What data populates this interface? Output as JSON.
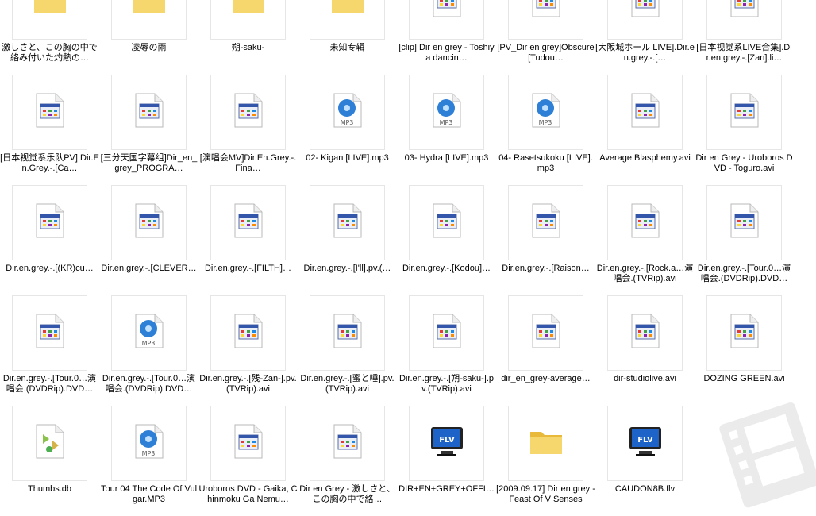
{
  "items": [
    {
      "label": "激しさと、この胸の中で絡み付いた灼熱の…",
      "icon": "folder-icon",
      "row": 0,
      "col": 0
    },
    {
      "label": "凌辱の雨",
      "icon": "folder-icon",
      "row": 0,
      "col": 1
    },
    {
      "label": "朔-saku-",
      "icon": "folder-icon",
      "row": 0,
      "col": 2
    },
    {
      "label": "未知专辑",
      "icon": "folder-icon",
      "row": 0,
      "col": 3
    },
    {
      "label": "[clip] Dir en grey - Toshiya dancin…",
      "icon": "video-file-icon",
      "row": 0,
      "col": 4
    },
    {
      "label": "[PV_Dir en grey]Obscure[Tudou…",
      "icon": "video-file-icon",
      "row": 0,
      "col": 5
    },
    {
      "label": "[大阪城ホール LIVE].Dir.en.grey.-.[…",
      "icon": "video-file-icon",
      "row": 0,
      "col": 6
    },
    {
      "label": "[日本视觉系LIVE合集].Dir.en.grey.-.[Zan].li…",
      "icon": "video-file-icon",
      "row": 0,
      "col": 7
    },
    {
      "label": "[日本视觉系乐队PV].Dir.En.Grey.-.[Ca…",
      "icon": "video-file-icon",
      "row": 1,
      "col": 0
    },
    {
      "label": "[三分天国字幕组]Dir_en_grey_PROGRA…",
      "icon": "video-file-icon",
      "row": 1,
      "col": 1
    },
    {
      "label": "[演唱会MV]Dir.En.Grey.-.Fina…",
      "icon": "video-file-icon",
      "row": 1,
      "col": 2
    },
    {
      "label": "02- Kigan [LIVE].mp3",
      "icon": "mp3-file-icon",
      "row": 1,
      "col": 3
    },
    {
      "label": "03- Hydra [LIVE].mp3",
      "icon": "mp3-file-icon",
      "row": 1,
      "col": 4
    },
    {
      "label": "04- Rasetsukoku [LIVE].mp3",
      "icon": "mp3-file-icon",
      "row": 1,
      "col": 5
    },
    {
      "label": "Average Blasphemy.avi",
      "icon": "video-file-icon",
      "row": 1,
      "col": 6
    },
    {
      "label": "Dir en Grey - Uroboros DVD - Toguro.avi",
      "icon": "video-file-icon",
      "row": 1,
      "col": 7
    },
    {
      "label": "Dir.en.grey.-.[(KR)cu…",
      "icon": "video-file-icon",
      "row": 2,
      "col": 0
    },
    {
      "label": "Dir.en.grey.-.[CLEVER…",
      "icon": "video-file-icon",
      "row": 2,
      "col": 1
    },
    {
      "label": "Dir.en.grey.-.[FILTH]…",
      "icon": "video-file-icon",
      "row": 2,
      "col": 2
    },
    {
      "label": "Dir.en.grey.-.[I'll].pv.(…",
      "icon": "video-file-icon",
      "row": 2,
      "col": 3
    },
    {
      "label": "Dir.en.grey.-.[Kodou]…",
      "icon": "video-file-icon",
      "row": 2,
      "col": 4
    },
    {
      "label": "Dir.en.grey.-.[Raison…",
      "icon": "video-file-icon",
      "row": 2,
      "col": 5
    },
    {
      "label": "Dir.en.grey.-.[Rock.a…演唱会.(TVRip).avi",
      "icon": "video-file-icon",
      "row": 2,
      "col": 6
    },
    {
      "label": "Dir.en.grey.-.[Tour.0…演唱会.(DVDRip).DVD…",
      "icon": "video-file-icon",
      "row": 2,
      "col": 7
    },
    {
      "label": "Dir.en.grey.-.[Tour.0…演唱会.(DVDRip).DVD…",
      "icon": "video-file-icon",
      "row": 3,
      "col": 0
    },
    {
      "label": "Dir.en.grey.-.[Tour.0…演唱会.(DVDRip).DVD…",
      "icon": "mp3-file-icon",
      "row": 3,
      "col": 1
    },
    {
      "label": "Dir.en.grey.-.[残-Zan-].pv.(TVRip).avi",
      "icon": "video-file-icon",
      "row": 3,
      "col": 2
    },
    {
      "label": "Dir.en.grey.-.[蜜と唾].pv.(TVRip).avi",
      "icon": "video-file-icon",
      "row": 3,
      "col": 3
    },
    {
      "label": "Dir.en.grey.-.[朔-saku-].pv.(TVRip).avi",
      "icon": "video-file-icon",
      "row": 3,
      "col": 4
    },
    {
      "label": "dir_en_grey-average…",
      "icon": "video-file-icon",
      "row": 3,
      "col": 5
    },
    {
      "label": "dir-studiolive.avi",
      "icon": "video-file-icon",
      "row": 3,
      "col": 6
    },
    {
      "label": "DOZING GREEN.avi",
      "icon": "video-file-icon",
      "row": 3,
      "col": 7
    },
    {
      "label": "Thumbs.db",
      "icon": "db-file-icon",
      "row": 4,
      "col": 0
    },
    {
      "label": "Tour 04 The Code Of Vulgar.MP3",
      "icon": "mp3-file-icon",
      "row": 4,
      "col": 1
    },
    {
      "label": "Uroboros DVD - Gaika, Chinmoku Ga Nemu…",
      "icon": "video-file-icon",
      "row": 4,
      "col": 2
    },
    {
      "label": "Dir en Grey - 激しさと、この胸の中で絡…",
      "icon": "video-file-icon",
      "row": 4,
      "col": 3
    },
    {
      "label": "DIR+EN+GREY+OFFI…",
      "icon": "flv-file-icon",
      "row": 4,
      "col": 4
    },
    {
      "label": "[2009.09.17] Dir en grey - Feast Of V Senses",
      "icon": "folder-icon",
      "row": 4,
      "col": 5
    },
    {
      "label": "CAUDON8B.flv",
      "icon": "flv-file-icon",
      "row": 4,
      "col": 6
    }
  ],
  "colors": {
    "folder": "#f5d76e",
    "folder_dark": "#e8b93a",
    "mp3_disc": "#2e7fd6",
    "flv_screen": "#1e64c8"
  },
  "icon_text": {
    "mp3": "MP3",
    "flv": "FLV"
  }
}
